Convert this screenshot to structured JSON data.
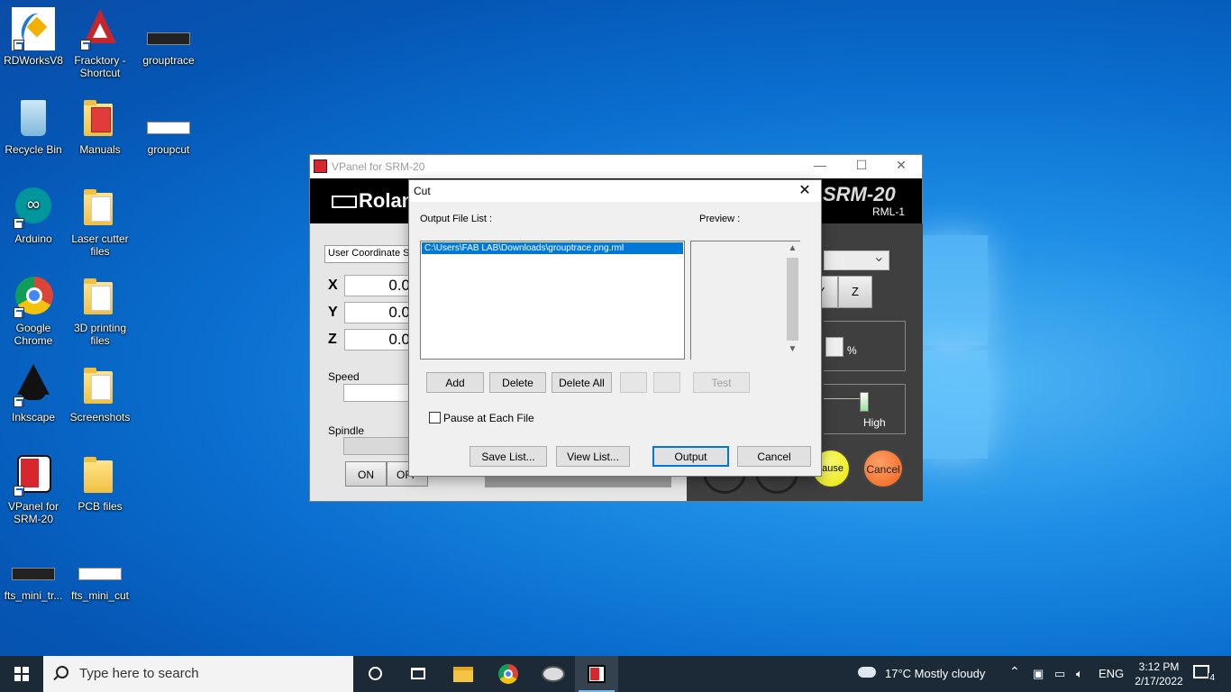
{
  "desktop": {
    "icons": [
      {
        "label": "RDWorksV8"
      },
      {
        "label": "Fracktory - Shortcut"
      },
      {
        "label": "grouptrace"
      },
      {
        "label": "Recycle Bin"
      },
      {
        "label": "Manuals"
      },
      {
        "label": "groupcut"
      },
      {
        "label": "Arduino"
      },
      {
        "label": "Laser cutter files"
      },
      {
        "label": "Google Chrome"
      },
      {
        "label": "3D printing files"
      },
      {
        "label": "Inkscape"
      },
      {
        "label": "Screenshots"
      },
      {
        "label": "VPanel for SRM-20"
      },
      {
        "label": "PCB files"
      },
      {
        "label": "fts_mini_tr..."
      },
      {
        "label": "fts_mini_cut"
      }
    ]
  },
  "vpanel": {
    "title": "VPanel for SRM-20",
    "brand": "Roland",
    "model": "SRM-20",
    "submodel": "RML-1",
    "coord_system": "User Coordinate System",
    "axes": [
      {
        "axis": "X",
        "value": "0.0"
      },
      {
        "axis": "Y",
        "value": "0.0"
      },
      {
        "axis": "Z",
        "value": "0.0"
      }
    ],
    "speed_label": "Speed",
    "spindle_label": "Spindle",
    "on_label": "ON",
    "off_label": "OFF",
    "y_btn": "Y",
    "z_btn": "Z",
    "percent": "%",
    "high_label": "High",
    "pause_label": "Pause",
    "cancel_label": "Cancel"
  },
  "cut_dialog": {
    "title": "Cut",
    "output_list_label": "Output File List :",
    "preview_label": "Preview :",
    "files": [
      "C:\\Users\\FAB LAB\\Downloads\\grouptrace.png.rml"
    ],
    "buttons": {
      "add": "Add",
      "delete": "Delete",
      "delete_all": "Delete All",
      "test": "Test",
      "save_list": "Save List...",
      "view_list": "View List...",
      "output": "Output",
      "cancel": "Cancel"
    },
    "pause_each_file": "Pause at Each File"
  },
  "taskbar": {
    "search_placeholder": "Type here to search",
    "weather": "17°C  Mostly cloudy",
    "language": "ENG",
    "time": "3:12 PM",
    "date": "2/17/2022",
    "notifications": "4"
  }
}
